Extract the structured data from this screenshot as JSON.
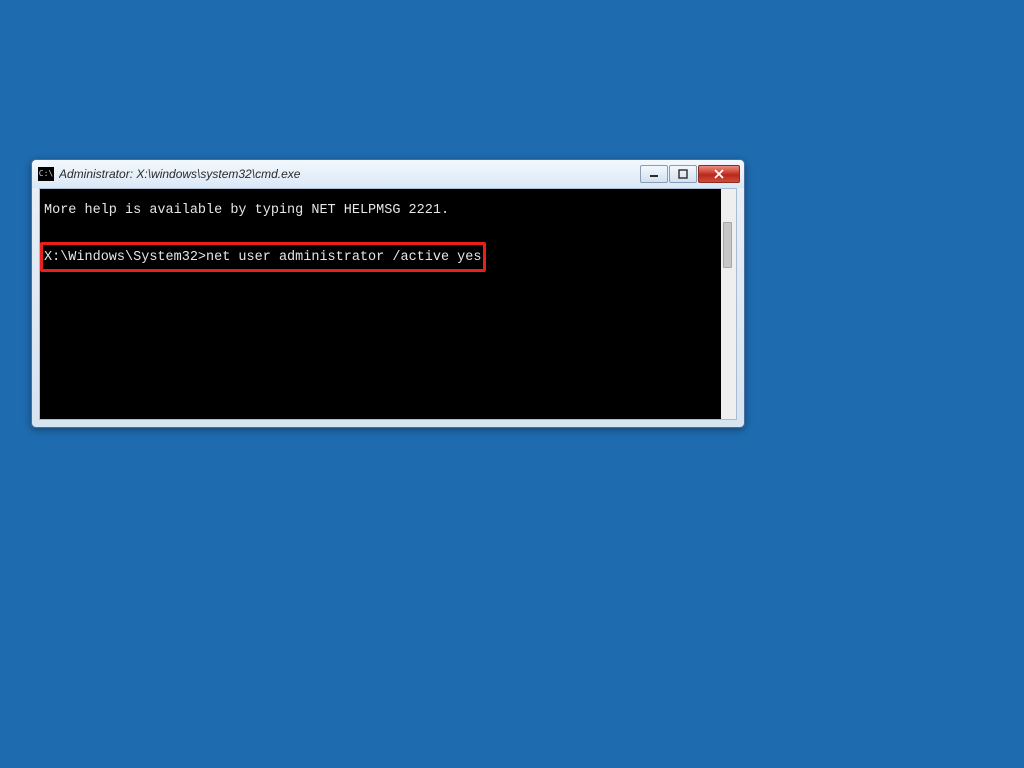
{
  "window": {
    "title": "Administrator: X:\\windows\\system32\\cmd.exe",
    "icon_label": "C:\\"
  },
  "terminal": {
    "line1": "More help is available by typing NET HELPMSG 2221.",
    "prompt": "X:\\Windows\\System32>",
    "command": "net user administrator /active yes"
  }
}
